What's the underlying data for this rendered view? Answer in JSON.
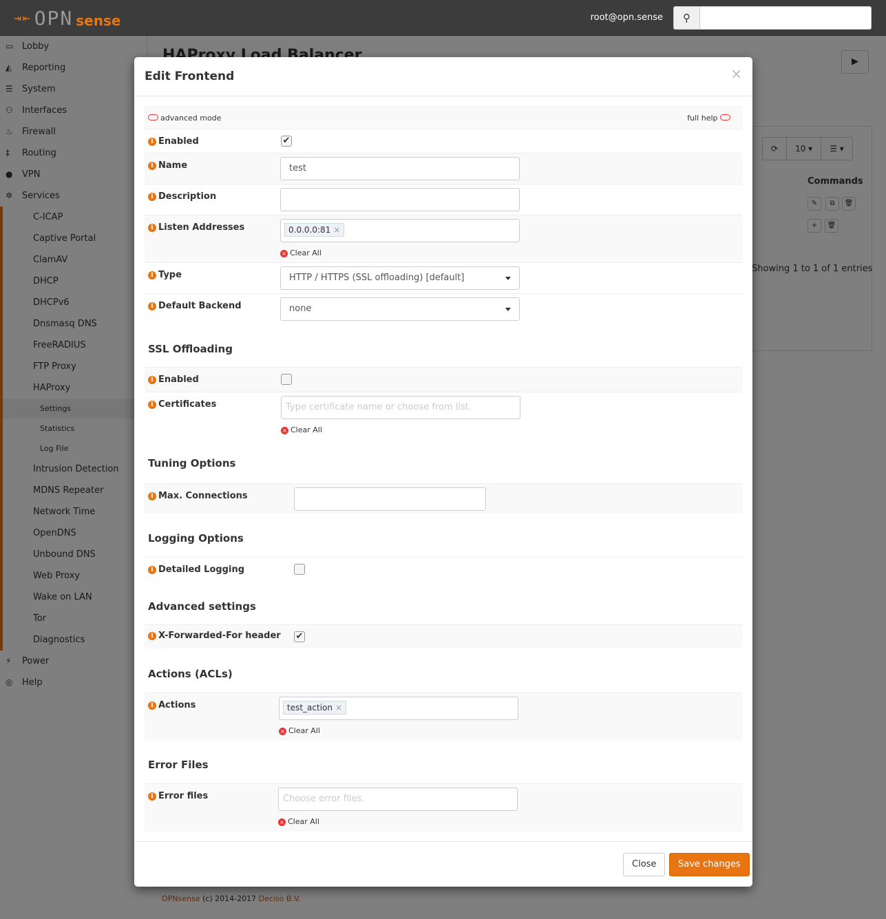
{
  "header": {
    "logo_text": "OPNsense",
    "user": "root@opn.sense",
    "search_placeholder": ""
  },
  "sidebar": {
    "items": [
      {
        "label": "Lobby",
        "icon": "laptop-icon",
        "level": 0
      },
      {
        "label": "Reporting",
        "icon": "area-chart-icon",
        "level": 0
      },
      {
        "label": "System",
        "icon": "server-icon",
        "level": 0
      },
      {
        "label": "Interfaces",
        "icon": "sitemap-icon",
        "level": 0
      },
      {
        "label": "Firewall",
        "icon": "fire-icon",
        "level": 0
      },
      {
        "label": "Routing",
        "icon": "signpost-icon",
        "level": 0
      },
      {
        "label": "VPN",
        "icon": "globe-icon",
        "level": 0
      },
      {
        "label": "Services",
        "icon": "cog-icon",
        "level": 0
      },
      {
        "label": "C-ICAP",
        "level": 1
      },
      {
        "label": "Captive Portal",
        "level": 1
      },
      {
        "label": "ClamAV",
        "level": 1
      },
      {
        "label": "DHCP",
        "level": 1
      },
      {
        "label": "DHCPv6",
        "level": 1
      },
      {
        "label": "Dnsmasq DNS",
        "level": 1
      },
      {
        "label": "FreeRADIUS",
        "level": 1
      },
      {
        "label": "FTP Proxy",
        "level": 1
      },
      {
        "label": "HAProxy",
        "level": 1
      },
      {
        "label": "Settings",
        "level": 2,
        "active": true
      },
      {
        "label": "Statistics",
        "level": 2
      },
      {
        "label": "Log File",
        "level": 2
      },
      {
        "label": "Intrusion Detection",
        "level": 1
      },
      {
        "label": "MDNS Repeater",
        "level": 1
      },
      {
        "label": "Network Time",
        "level": 1
      },
      {
        "label": "OpenDNS",
        "level": 1
      },
      {
        "label": "Unbound DNS",
        "level": 1
      },
      {
        "label": "Web Proxy",
        "level": 1
      },
      {
        "label": "Wake on LAN",
        "level": 1
      },
      {
        "label": "Tor",
        "level": 1
      },
      {
        "label": "Diagnostics",
        "level": 1
      },
      {
        "label": "Power",
        "icon": "plug-icon",
        "level": 0
      },
      {
        "label": "Help",
        "icon": "life-ring-icon",
        "level": 0
      }
    ]
  },
  "main": {
    "title": "HAProxy Load Balancer",
    "page_size": "10",
    "commands_header": "Commands",
    "showing": "Showing 1 to 1 of 1 entries"
  },
  "footer": {
    "brand": "OPNsense",
    "copyright": "(c) 2014-2017",
    "company": "Deciso B.V."
  },
  "modal": {
    "title": "Edit Frontend",
    "close_x": "×",
    "advanced_mode": "advanced mode",
    "full_help": "full help",
    "clear_all": "Clear All",
    "fields": {
      "enabled": {
        "label": "Enabled",
        "checked": true
      },
      "name": {
        "label": "Name",
        "value": "test"
      },
      "description": {
        "label": "Description",
        "value": ""
      },
      "listen": {
        "label": "Listen Addresses",
        "tags": [
          "0.0.0.0:81"
        ]
      },
      "type": {
        "label": "Type",
        "value": "HTTP / HTTPS (SSL offloading) [default]"
      },
      "backend": {
        "label": "Default Backend",
        "value": "none"
      },
      "ssl_enabled": {
        "label": "Enabled",
        "checked": false
      },
      "certificates": {
        "label": "Certificates",
        "placeholder": "Type certificate name or choose from list."
      },
      "maxconn": {
        "label": "Max. Connections",
        "value": ""
      },
      "detailed_logging": {
        "label": "Detailed Logging",
        "checked": false
      },
      "xff": {
        "label": "X-Forwarded-For header",
        "checked": true
      },
      "actions": {
        "label": "Actions",
        "tags": [
          "test_action"
        ]
      },
      "error_files": {
        "label": "Error files",
        "placeholder": "Choose error files."
      }
    },
    "sections": {
      "ssl": "SSL Offloading",
      "tuning": "Tuning Options",
      "logging": "Logging Options",
      "advanced": "Advanced settings",
      "acls": "Actions (ACLs)",
      "errors": "Error Files"
    },
    "buttons": {
      "close": "Close",
      "save": "Save changes"
    }
  },
  "colors": {
    "accent": "#e87511",
    "header_bg": "#3c3c3c",
    "danger": "#e33333"
  }
}
